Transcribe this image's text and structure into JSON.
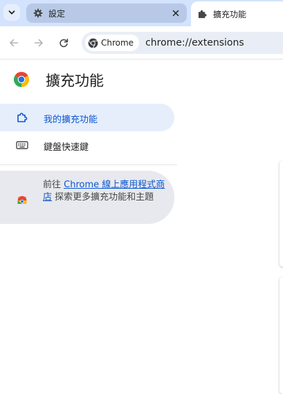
{
  "tabstrip": {
    "search_icon": "chevron-down-icon",
    "tabs": [
      {
        "title": "設定",
        "icon": "gear-icon",
        "active": false
      },
      {
        "title": "擴充功能",
        "icon": "puzzle-icon",
        "active": true
      }
    ]
  },
  "toolbar": {
    "site_chip_label": "Chrome",
    "url": "chrome://extensions"
  },
  "page": {
    "title": "擴充功能"
  },
  "sidebar": {
    "items": [
      {
        "label": "我的擴充功能",
        "icon": "puzzle-outline-icon",
        "selected": true
      },
      {
        "label": "鍵盤快速鍵",
        "icon": "keyboard-icon",
        "selected": false
      }
    ],
    "webstore": {
      "prefix": "前往 ",
      "link": "Chrome 線上應用程式商店",
      "suffix": " 探索更多擴充功能和主題"
    }
  },
  "colors": {
    "tabstrip_bg": "#d3e3fd",
    "accent": "#0b57d0",
    "selected_bg": "#e6eefc"
  }
}
